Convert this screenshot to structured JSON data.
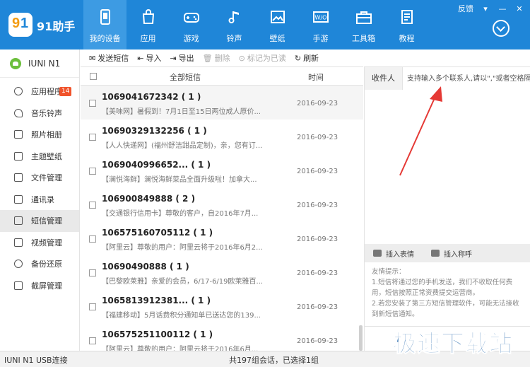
{
  "header": {
    "app_title": "91助手",
    "nav": [
      {
        "label": "我的设备",
        "icon": "phone-icon",
        "active": true
      },
      {
        "label": "应用",
        "icon": "bag-icon"
      },
      {
        "label": "游戏",
        "icon": "gamepad-icon"
      },
      {
        "label": "铃声",
        "icon": "music-note-icon"
      },
      {
        "label": "壁纸",
        "icon": "picture-icon"
      },
      {
        "label": "手游",
        "icon": "wo-icon"
      },
      {
        "label": "工具箱",
        "icon": "toolbox-icon"
      },
      {
        "label": "教程",
        "icon": "book-icon"
      }
    ],
    "feedback": "反馈",
    "accent_color": "#1f86d8"
  },
  "sidebar": {
    "device_name": "IUNI N1",
    "badge": "14",
    "items": [
      {
        "label": "应用程序",
        "icon": "apps-icon"
      },
      {
        "label": "音乐铃声",
        "icon": "music-icon"
      },
      {
        "label": "照片相册",
        "icon": "camera-icon"
      },
      {
        "label": "主题壁纸",
        "icon": "theme-icon"
      },
      {
        "label": "文件管理",
        "icon": "folder-icon"
      },
      {
        "label": "通讯录",
        "icon": "contacts-icon"
      },
      {
        "label": "短信管理",
        "icon": "sms-icon",
        "active": true
      },
      {
        "label": "视频管理",
        "icon": "video-icon"
      },
      {
        "label": "备份还原",
        "icon": "backup-icon"
      },
      {
        "label": "截屏管理",
        "icon": "crop-icon"
      }
    ]
  },
  "toolbar": {
    "send": "发送短信",
    "import": "导入",
    "export": "导出",
    "delete": "删除",
    "mark_read": "标记为已读",
    "refresh": "刷新"
  },
  "list": {
    "col_all": "全部短信",
    "col_time": "时间",
    "messages": [
      {
        "number": "1069041672342 ( 1 )",
        "preview": "【美味网】暑假到！7月1日至15日两位成人原价...",
        "date": "2016-09-23"
      },
      {
        "number": "10690329132256 ( 1 )",
        "preview": "【人人快递网】(福州舒洁甜品定制)，亲，您有订...",
        "date": "2016-09-23"
      },
      {
        "number": "1069040996652... ( 1 )",
        "preview": "【澜悦海鲜】澜悦海鲜菜品全面升级啦！加拿大...",
        "date": "2016-09-23"
      },
      {
        "number": "106900849888 ( 2 )",
        "preview": "【交通银行信用卡】尊敬的客户，自2016年7月...",
        "date": "2016-09-23"
      },
      {
        "number": "106575160705112 ( 1 )",
        "preview": "【阿里云】尊敬的用户：阿里云将于2016年6月2...",
        "date": "2016-09-23"
      },
      {
        "number": "10690490888 ( 1 )",
        "preview": "【巴黎欧莱雅】亲爱的会员，6/17-6/19欧莱雅百...",
        "date": "2016-09-23"
      },
      {
        "number": "1065813912381... ( 1 )",
        "preview": "【福建移动】5月话费积分通知单已送达您的139...",
        "date": "2016-09-23"
      },
      {
        "number": "106575251100112 ( 1 )",
        "preview": "【阿里云】尊敬的用户：阿里云将于2016年6月...",
        "date": "2016-09-23"
      }
    ]
  },
  "right": {
    "recipient_label": "收件人",
    "recipient_placeholder": "支持输入多个联系人,请以\",\"或者空格隔开",
    "insert_emoji": "插入表情",
    "insert_nickname": "插入称呼",
    "hint_title": "友情提示：",
    "hint_1": "1.短信将通过您的手机发送，我们不收取任何费用，短信按照正常资费提交运营商。",
    "hint_2": "2.若您安装了第三方短信管理软件，可能无法接收到新短信通知。"
  },
  "status": {
    "device": "IUNI N1  USB连接",
    "summary": "共197组会话，已选择1组"
  },
  "watermark": "极速下载站"
}
